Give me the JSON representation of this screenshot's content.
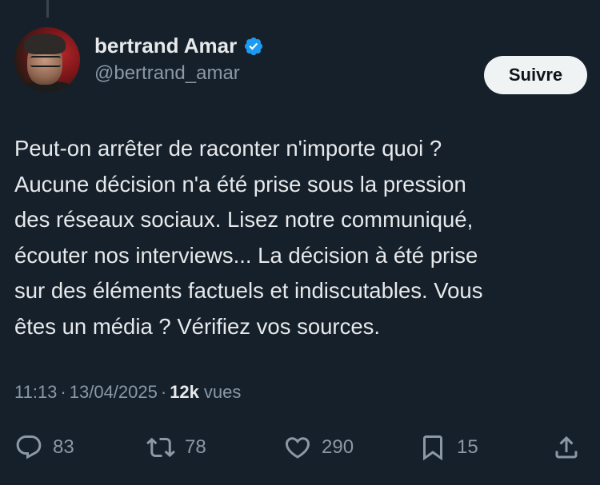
{
  "author": {
    "display_name": "bertrand Amar",
    "handle": "@bertrand_amar",
    "verified_color": "#1d9bf0"
  },
  "follow_button": {
    "label": "Suivre"
  },
  "tweet": {
    "text": "Peut-on arrêter de raconter n'importe quoi ?\nAucune décision n'a été prise sous la pression\ndes réseaux sociaux. Lisez notre communiqué,\nécouter nos interviews... La décision à été prise\nsur des éléments factuels et indiscutables. Vous\nêtes un média ? Vérifiez vos sources."
  },
  "meta": {
    "time": "11:13",
    "date": "13/04/2025",
    "separator": "·",
    "views_count": "12k",
    "views_label": "vues"
  },
  "actions": {
    "replies": "83",
    "retweets": "78",
    "likes": "290",
    "bookmarks": "15"
  },
  "icons": {
    "reply": "reply-icon",
    "retweet": "retweet-icon",
    "like": "heart-icon",
    "bookmark": "bookmark-icon",
    "share": "share-icon"
  },
  "colors": {
    "background": "#15202b",
    "text": "#e7e9ea",
    "muted": "#8b98a5",
    "button_bg": "#eff3f4"
  }
}
